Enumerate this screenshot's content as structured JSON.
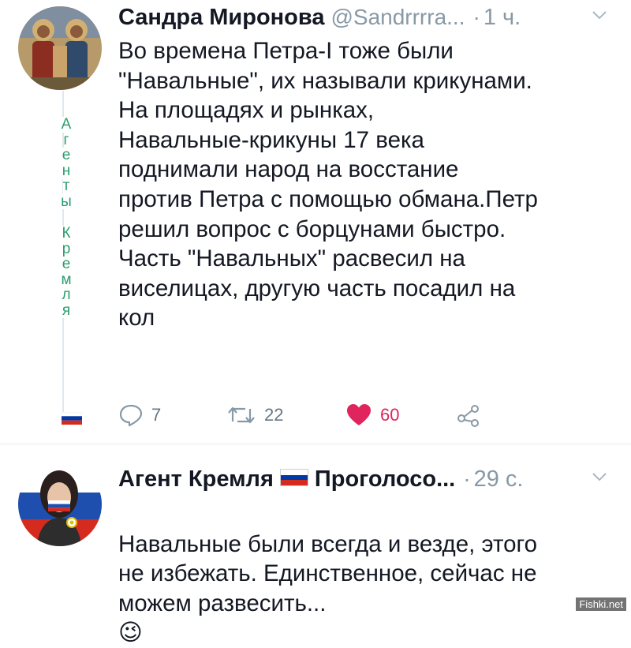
{
  "tweet1": {
    "name": "Сандра Миронова",
    "handle": "@Sandrrrra...",
    "dot": "·",
    "time": "1 ч.",
    "chevron": "chevron-down-icon",
    "text": "Во времена Петра-I тоже были\n\"Навальные\", их называли крикунами.\nНа площадях и рынках,\nНавальные-крикуны 17 века\nподнимали народ на восстание\nпротив Петра с помощью обмана.Петр\nрешил вопрос с борцунами быстро.\nЧасть \"Навальных\" расвесил на\nвиселицах, другую часть посадил на\nкол",
    "actions": {
      "reply_icon": "reply-icon",
      "reply_count": "7",
      "retweet_icon": "retweet-icon",
      "retweet_count": "22",
      "like_icon": "heart-icon",
      "like_count": "60",
      "share_icon": "share-icon"
    }
  },
  "thread_letters": {
    "word1": [
      "А",
      "г",
      "е",
      "н",
      "т",
      "ы"
    ],
    "word2": [
      "К",
      "р",
      "е",
      "м",
      "л",
      "я"
    ]
  },
  "tweet2": {
    "name_part1": "Агент Кремля",
    "name_part2": "Проголосо...",
    "dot": "·",
    "time": "29 с.",
    "chevron": "chevron-down-icon",
    "text": "Навальные были всегда и везде, этого\nне избежать. Единственное, сейчас не\nможем развесить...",
    "emoji": "😉"
  },
  "watermark": "Fishki.net",
  "colors": {
    "like": "#e0245e",
    "muted": "#8899a6",
    "thread_letters": "#2b9d6e",
    "flag_white": "#ffffff",
    "flag_blue": "#0039a6",
    "flag_red": "#d52b1e"
  }
}
